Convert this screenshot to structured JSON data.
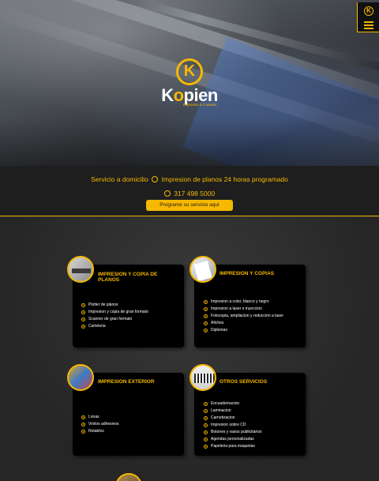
{
  "brand": {
    "logo_letter": "K",
    "name_first": "K",
    "name_o": "o",
    "name_rest": "pien",
    "tagline": "Impresion & Copiado"
  },
  "menu": {
    "logo_letter": "K",
    "icon": "hamburger-icon"
  },
  "info": {
    "line1_part1": "Servicio a domicilio",
    "line1_part2": "Impresion de planos 24 horas programado",
    "phone": "317 498 5000",
    "cta": "Programe su servicio aquí"
  },
  "colors": {
    "accent": "#f6b800",
    "card": "#000000",
    "text": "#ffffff"
  },
  "cards": [
    {
      "title": "IMPRESION Y COPIA DE PLANOS",
      "items": [
        "Plotter de planos",
        "Impresion y copia de gran formato",
        "Scanner de gran formato",
        "Carteleria"
      ]
    },
    {
      "title": "IMPRESION Y COPIAS",
      "items": [
        "Impresion a color, blanco y negro",
        "Impresion a laser e inyeccion",
        "Fotocopia, ampliacion y reduccion a laser",
        "Afiches",
        "Diplomas"
      ]
    },
    {
      "title": "IMPRESION EXTERIOR",
      "items": [
        "Lonas",
        "Vinilos adhesivos",
        "Retablos"
      ]
    },
    {
      "title": "OTROS SERVICIOS",
      "items": [
        "Encuadernacion",
        "Laminacion",
        "Carnetizacion",
        "Impresion sobre CD",
        "Botones y vasos publicitarios",
        "Agendas personalizadas",
        "Papeleria para maquetas"
      ]
    }
  ]
}
